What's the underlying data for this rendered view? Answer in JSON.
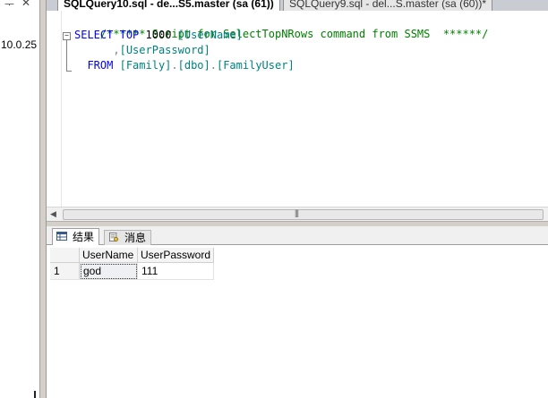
{
  "left_pane": {
    "pin_glyph": "ᅮ",
    "close_glyph": "✕",
    "server_version_fragment": "10.0.25"
  },
  "tabs": [
    {
      "label": "SQLQuery10.sql - de...S5.master (sa (61))",
      "active": true
    },
    {
      "label": "SQLQuery9.sql - del...S.master (sa (60))*",
      "active": false
    }
  ],
  "editor": {
    "lines": {
      "comment": "/****** Script for SelectTopNRows command from SSMS  ******/",
      "select_kw": "SELECT",
      "top_kw": "TOP",
      "top_value": "1000",
      "col1": "[UserName]",
      "comma": ",",
      "col2": "[UserPassword]",
      "from_kw": "FROM",
      "db": "[Family]",
      "dot1": ".",
      "schema": "[dbo]",
      "dot2": ".",
      "table": "[FamilyUser]"
    }
  },
  "results_tabs": {
    "results_label": "结果",
    "messages_label": "消息"
  },
  "grid": {
    "columns": [
      "UserName",
      "UserPassword"
    ],
    "rows": [
      {
        "num": "1",
        "cells": [
          "god",
          "111"
        ]
      }
    ]
  },
  "colors": {
    "keyword": "#0000ff",
    "comment": "#008000",
    "identifier": "#008080",
    "operator": "#808080"
  }
}
